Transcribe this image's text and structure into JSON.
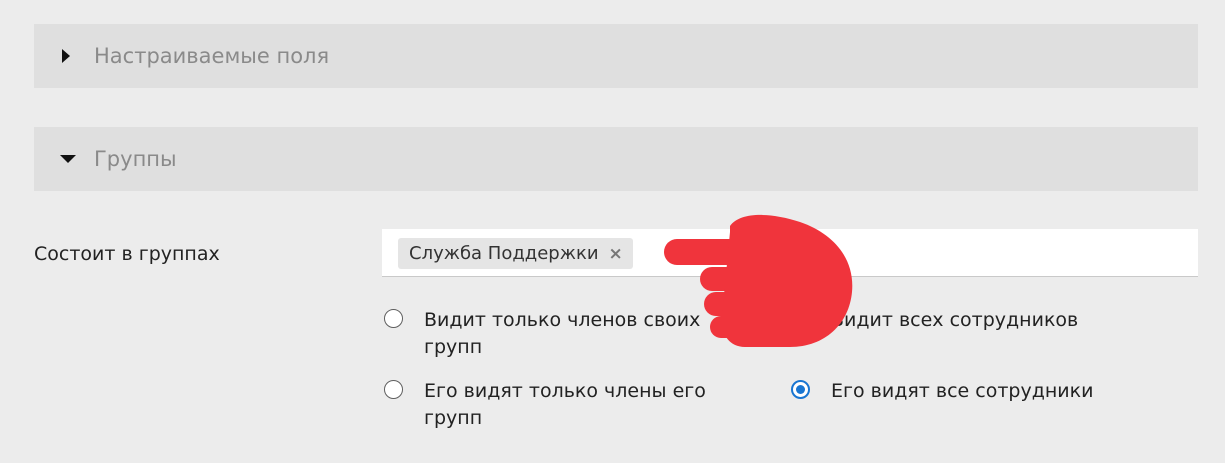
{
  "sections": {
    "custom_fields": {
      "title": "Настраиваемые поля",
      "expanded": false
    },
    "groups": {
      "title": "Группы",
      "expanded": true
    }
  },
  "groups_field": {
    "label": "Состоит в группах",
    "tags": [
      {
        "label": "Служба Поддержки",
        "remove": "×"
      }
    ]
  },
  "visibility": {
    "see": {
      "options": [
        {
          "label": "Видит только членов своих групп",
          "checked": false
        },
        {
          "label": "Видит всех сотрудников",
          "checked": false
        }
      ]
    },
    "seen_by": {
      "options": [
        {
          "label": "Его видят только члены его групп",
          "checked": false
        },
        {
          "label": "Его видят все сотрудники",
          "checked": true
        }
      ]
    }
  },
  "colors": {
    "radio_checked": "#1976d2",
    "pointer_hand": "#f0343c"
  },
  "icons": {
    "collapsed_caret": "caret-right-icon",
    "expanded_caret": "caret-down-icon",
    "pointer": "pointing-hand-icon"
  }
}
